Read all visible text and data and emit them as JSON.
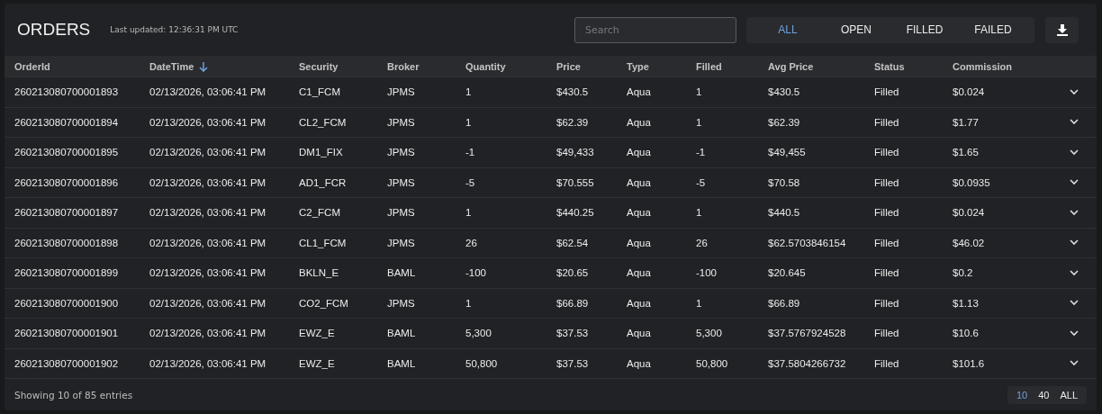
{
  "header": {
    "title": "ORDERS",
    "last_updated": "Last updated: 12:36:31 PM UTC"
  },
  "search": {
    "placeholder": "Search"
  },
  "filters": [
    {
      "label": "ALL",
      "selected": true
    },
    {
      "label": "OPEN",
      "selected": false
    },
    {
      "label": "FILLED",
      "selected": false
    },
    {
      "label": "FAILED",
      "selected": false
    }
  ],
  "table": {
    "columns": [
      {
        "label": "OrderId",
        "sorted": false
      },
      {
        "label": "DateTime",
        "sorted": true
      },
      {
        "label": "Security",
        "sorted": false
      },
      {
        "label": "Broker",
        "sorted": false
      },
      {
        "label": "Quantity",
        "sorted": false
      },
      {
        "label": "Price",
        "sorted": false
      },
      {
        "label": "Type",
        "sorted": false
      },
      {
        "label": "Filled",
        "sorted": false
      },
      {
        "label": "Avg Price",
        "sorted": false
      },
      {
        "label": "Status",
        "sorted": false
      },
      {
        "label": "Commission",
        "sorted": false
      }
    ],
    "rows": [
      [
        "260213080700001893",
        "02/13/2026, 03:06:41 PM",
        "C1_FCM",
        "JPMS",
        "1",
        "$430.5",
        "Aqua",
        "1",
        "$430.5",
        "Filled",
        "$0.024"
      ],
      [
        "260213080700001894",
        "02/13/2026, 03:06:41 PM",
        "CL2_FCM",
        "JPMS",
        "1",
        "$62.39",
        "Aqua",
        "1",
        "$62.39",
        "Filled",
        "$1.77"
      ],
      [
        "260213080700001895",
        "02/13/2026, 03:06:41 PM",
        "DM1_FIX",
        "JPMS",
        "-1",
        "$49,433",
        "Aqua",
        "-1",
        "$49,455",
        "Filled",
        "$1.65"
      ],
      [
        "260213080700001896",
        "02/13/2026, 03:06:41 PM",
        "AD1_FCR",
        "JPMS",
        "-5",
        "$70.555",
        "Aqua",
        "-5",
        "$70.58",
        "Filled",
        "$0.0935"
      ],
      [
        "260213080700001897",
        "02/13/2026, 03:06:41 PM",
        "C2_FCM",
        "JPMS",
        "1",
        "$440.25",
        "Aqua",
        "1",
        "$440.5",
        "Filled",
        "$0.024"
      ],
      [
        "260213080700001898",
        "02/13/2026, 03:06:41 PM",
        "CL1_FCM",
        "JPMS",
        "26",
        "$62.54",
        "Aqua",
        "26",
        "$62.5703846154",
        "Filled",
        "$46.02"
      ],
      [
        "260213080700001899",
        "02/13/2026, 03:06:41 PM",
        "BKLN_E",
        "BAML",
        "-100",
        "$20.65",
        "Aqua",
        "-100",
        "$20.645",
        "Filled",
        "$0.2"
      ],
      [
        "260213080700001900",
        "02/13/2026, 03:06:41 PM",
        "CO2_FCM",
        "JPMS",
        "1",
        "$66.89",
        "Aqua",
        "1",
        "$66.89",
        "Filled",
        "$1.13"
      ],
      [
        "260213080700001901",
        "02/13/2026, 03:06:41 PM",
        "EWZ_E",
        "BAML",
        "5,300",
        "$37.53",
        "Aqua",
        "5,300",
        "$37.5767924528",
        "Filled",
        "$10.6"
      ],
      [
        "260213080700001902",
        "02/13/2026, 03:06:41 PM",
        "EWZ_E",
        "BAML",
        "50,800",
        "$37.53",
        "Aqua",
        "50,800",
        "$37.5804266732",
        "Filled",
        "$101.6"
      ]
    ]
  },
  "footer": {
    "summary": "Showing 10 of 85 entries"
  },
  "page_sizes": [
    {
      "label": "10",
      "selected": true
    },
    {
      "label": "40",
      "selected": false
    },
    {
      "label": "ALL",
      "selected": false
    }
  ]
}
